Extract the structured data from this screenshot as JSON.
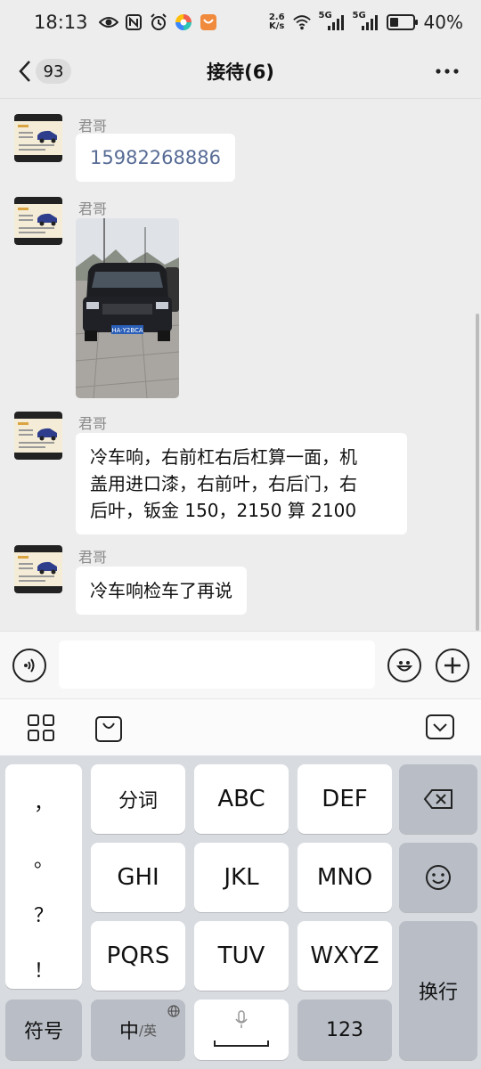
{
  "status_bar": {
    "time": "18:13",
    "speed_value": "2.6",
    "speed_unit": "K/s",
    "signal1": "5G",
    "signal2": "5G",
    "battery": "40%",
    "battery_level": 0.4
  },
  "header": {
    "back_count": "93",
    "title": "接待(6)"
  },
  "messages": [
    {
      "sender": "君哥",
      "type": "text",
      "text": "15982268886"
    },
    {
      "sender": "君哥",
      "type": "image",
      "plate": "HA·Y2BCA"
    },
    {
      "sender": "君哥",
      "type": "text",
      "lines": [
        "冷车响，右前杠右后杠算一面，机",
        "盖用进口漆，右前叶，右后门，右",
        "后叶，钣金 150，2150 算 2100"
      ]
    },
    {
      "sender": "君哥",
      "type": "text",
      "text": "冷车响检车了再说"
    }
  ],
  "keyboard": {
    "punct": [
      "，",
      "。",
      "？",
      "！"
    ],
    "row1": [
      "分词",
      "ABC",
      "DEF"
    ],
    "row2": [
      "GHI",
      "JKL",
      "MNO"
    ],
    "row3": [
      "PQRS",
      "TUV",
      "WXYZ"
    ],
    "symbols": "符号",
    "zh_main": "中",
    "zh_sub": "/英",
    "numbers": "123",
    "enter": "换行"
  }
}
